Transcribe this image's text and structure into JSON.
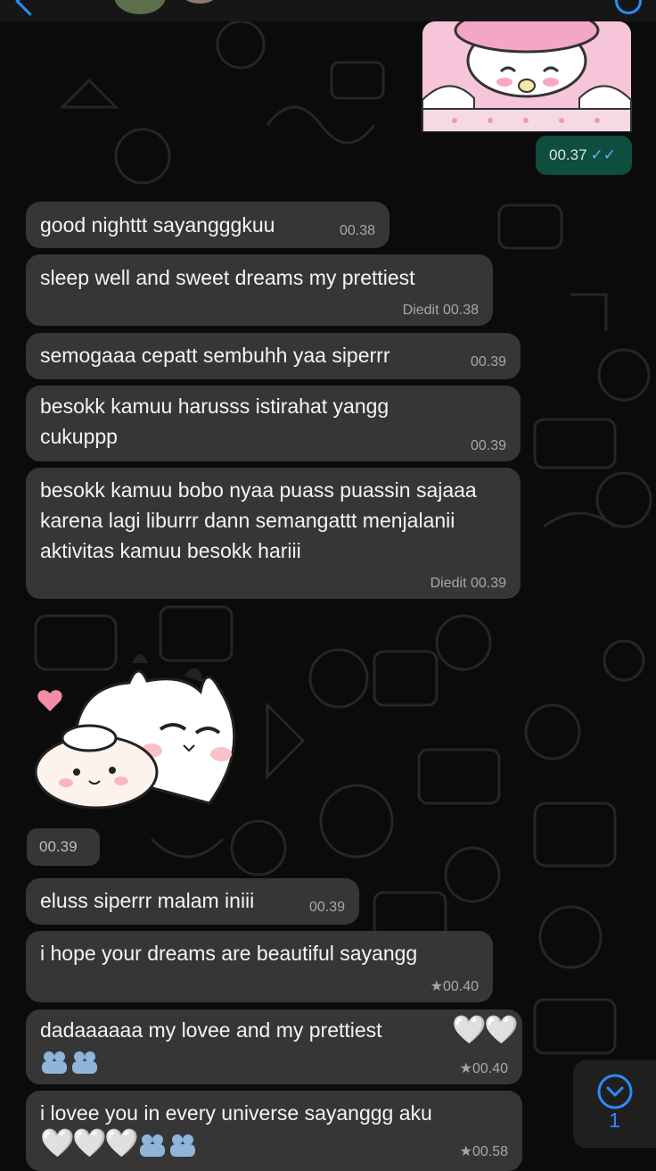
{
  "chat": {
    "outgoing_sticker_time": "00.37",
    "outgoing_ticks": "✓✓",
    "messages": [
      {
        "text": "good nighttt sayangggkuu",
        "meta": "00.38"
      },
      {
        "text": "sleep well and sweet dreams my prettiest",
        "meta": "Diedit 00.38"
      },
      {
        "text": "semogaaa cepatt sembuhh yaa siperrr",
        "meta": "00.39"
      },
      {
        "text": "besokk kamuu harusss istirahat yangg cukuppp",
        "meta": "00.39"
      },
      {
        "text": "besokk kamuu bobo nyaa puass puassin sajaaa karena lagi liburrr dann semangattt menjalanii aktivitas kamuu besokk hariii",
        "meta": "Diedit 00.39"
      },
      {
        "text": "eluss siperrr malam iniii",
        "meta": "00.39"
      },
      {
        "text": "i hope your dreams are beautiful sayangg",
        "meta": "★00.40"
      },
      {
        "text": "dadaaaaaa my lovee and my prettiest",
        "emoji": "🤍🤍🫂🫂",
        "meta": "★00.40"
      },
      {
        "text": "i lovee you in every universe sayanggg aku",
        "emoji": "🤍🤍🤍🫂🫂",
        "meta": "★00.58"
      }
    ],
    "incoming_sticker_time": "00.39"
  },
  "scroll_down": {
    "unread_count": "1"
  },
  "colors": {
    "background": "#0b0b0b",
    "incoming_bubble": "#363636",
    "outgoing_bubble": "#0f4d3e",
    "read_ticks": "#53b7ff",
    "accent": "#2a8cff"
  },
  "icons": [
    "back-chevron-icon",
    "contact-avatar",
    "call-icon",
    "chevron-down-icon",
    "double-check-icon",
    "white-heart-icon",
    "people-hugging-icon"
  ]
}
